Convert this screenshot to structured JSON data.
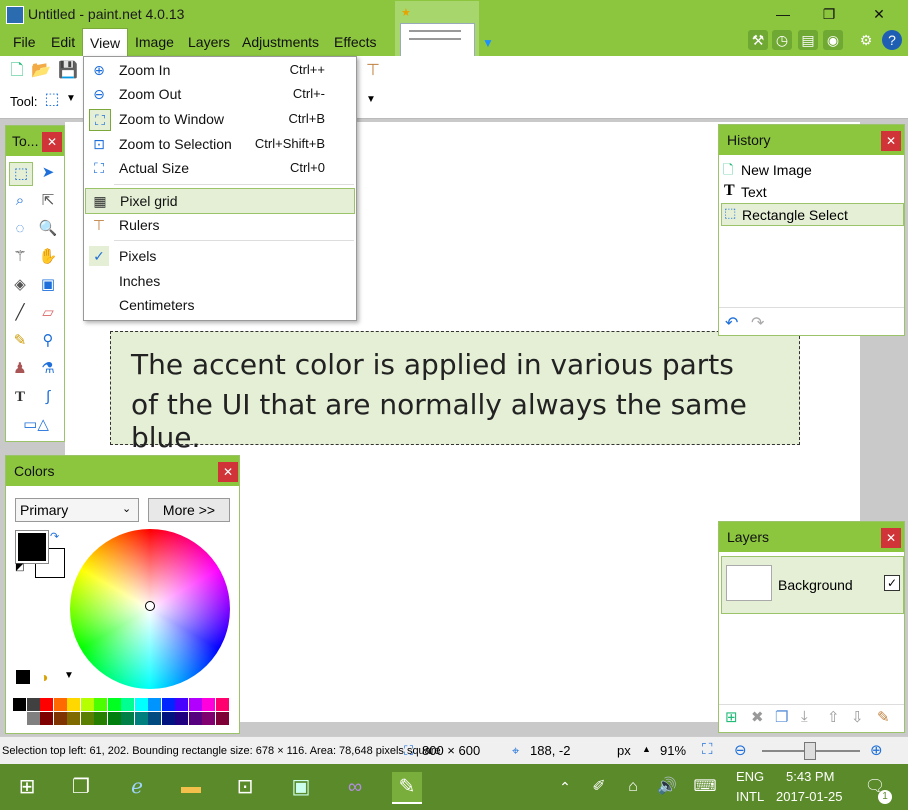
{
  "window": {
    "title": "Untitled - paint.net 4.0.13",
    "controls": {
      "minimize": "—",
      "maximize": "❐",
      "close": "✕"
    }
  },
  "menu": {
    "items": [
      "File",
      "Edit",
      "View",
      "Image",
      "Layers",
      "Adjustments",
      "Effects"
    ],
    "active": "View"
  },
  "toolbar": {
    "tool_label": "Tool:"
  },
  "view_menu": {
    "zoom_in": {
      "label": "Zoom In",
      "shortcut": "Ctrl++"
    },
    "zoom_out": {
      "label": "Zoom Out",
      "shortcut": "Ctrl+-"
    },
    "zoom_window": {
      "label": "Zoom to Window",
      "shortcut": "Ctrl+B"
    },
    "zoom_selection": {
      "label": "Zoom to Selection",
      "shortcut": "Ctrl+Shift+B"
    },
    "actual_size": {
      "label": "Actual Size",
      "shortcut": "Ctrl+0"
    },
    "pixel_grid": {
      "label": "Pixel grid"
    },
    "rulers": {
      "label": "Rulers"
    },
    "pixels": {
      "label": "Pixels",
      "checked": true
    },
    "inches": {
      "label": "Inches"
    },
    "centimeters": {
      "label": "Centimeters"
    }
  },
  "canvas": {
    "line1": "The accent color is applied in various parts",
    "line2": "of the UI that are normally always the same blue."
  },
  "tools_panel": {
    "title": "To..."
  },
  "history": {
    "title": "History",
    "items": [
      "New Image",
      "Text",
      "Rectangle Select"
    ],
    "selected": "Rectangle Select"
  },
  "colors": {
    "title": "Colors",
    "mode": "Primary",
    "more_button": "More >>",
    "primary": "#000000",
    "secondary": "#ffffff"
  },
  "layers": {
    "title": "Layers",
    "items": [
      {
        "name": "Background",
        "visible": true
      }
    ]
  },
  "status": {
    "selection_info": "Selection top left: 61, 202. Bounding rectangle size: 678 × 116. Area: 78,648 pixels square",
    "image_size": "800 × 600",
    "cursor": "188, -2",
    "units": "px",
    "zoom": "91%"
  },
  "taskbar": {
    "lang": "ENG",
    "layout": "INTL",
    "time": "5:43 PM",
    "date": "2017-01-25",
    "notifications": "1"
  },
  "theme": {
    "accent": "#8cc63f",
    "accent_light": "#e4efd6"
  }
}
